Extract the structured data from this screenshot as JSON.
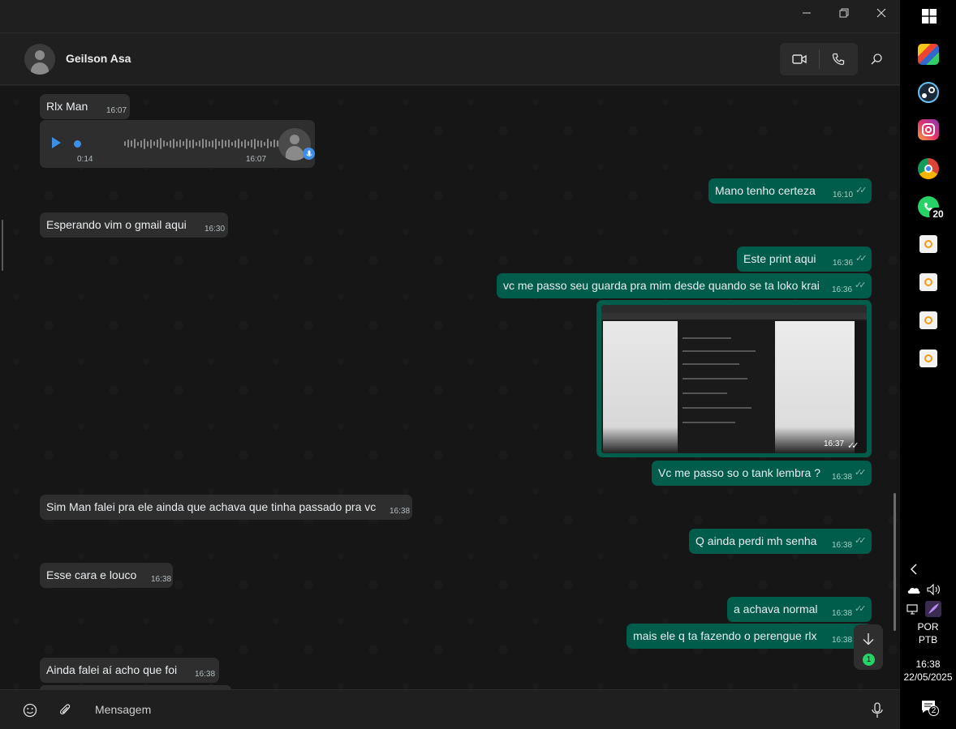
{
  "window": {
    "minimize": "—",
    "restore": "❐",
    "close": "✕"
  },
  "header": {
    "contact_name": "Geilson Asa"
  },
  "messages": [
    {
      "dir": "in",
      "text": "Rlx Man",
      "time": "16:07"
    },
    {
      "dir": "out",
      "text": "Mano tenho certeza",
      "time": "16:10"
    },
    {
      "dir": "in",
      "text": "Esperando vim o gmail aqui",
      "time": "16:30"
    },
    {
      "dir": "out",
      "text": "Este print aqui",
      "time": "16:36"
    },
    {
      "dir": "out",
      "text": "vc me passo seu guarda pra mim desde quando se ta loko krai",
      "time": "16:36"
    },
    {
      "dir": "out",
      "text": "Vc me passo so o tank lembra ?",
      "time": "16:38"
    },
    {
      "dir": "in",
      "text": "Sim Man falei pra ele ainda que achava que tinha passado pra vc",
      "time": "16:38"
    },
    {
      "dir": "out",
      "text": "Q ainda perdi mh senha",
      "time": "16:38"
    },
    {
      "dir": "in",
      "text": "Esse cara e louco",
      "time": "16:38"
    },
    {
      "dir": "out",
      "text": "a achava normal",
      "time": "16:38"
    },
    {
      "dir": "out",
      "text": "mais ele q ta fazendo o perengue rlx",
      "time": "16:38"
    },
    {
      "dir": "in",
      "text": "Ainda falei aí acho que foi",
      "time": "16:38"
    }
  ],
  "voice_note": {
    "duration": "0:14",
    "time": "16:07",
    "progress": 0
  },
  "image_message": {
    "time": "16:37"
  },
  "scroll_fab": {
    "unread": "1"
  },
  "composer": {
    "placeholder": "Mensagem"
  },
  "taskbar": {
    "whatsapp_badge": "20",
    "language": "POR",
    "layout": "PTB",
    "clock": "16:38",
    "date": "22/05/2025",
    "notifications": "2"
  },
  "colors": {
    "outgoing": "#005c4b",
    "incoming": "#2e2e2e",
    "accent": "#25d366",
    "background": "#161616"
  }
}
